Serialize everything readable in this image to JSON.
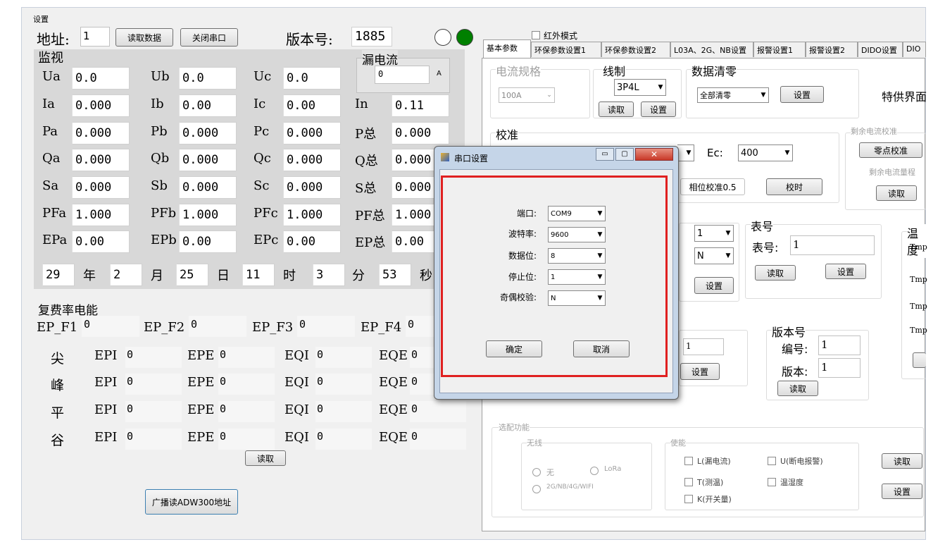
{
  "window": {
    "title": "设置"
  },
  "top": {
    "addr_label": "地址:",
    "addr_value": "1",
    "read_btn": "读取数据",
    "close_btn": "关闭串口",
    "ver_label": "版本号:",
    "ver_value": "1885"
  },
  "monitor": {
    "title": "监视",
    "leak_title": "漏电流",
    "leak_value": "0",
    "leak_unit": "A",
    "rows": [
      [
        {
          "l": "Ua",
          "v": "0.0"
        },
        {
          "l": "Ub",
          "v": "0.0"
        },
        {
          "l": "Uc",
          "v": "0.0"
        }
      ],
      [
        {
          "l": "Ia",
          "v": "0.000"
        },
        {
          "l": "Ib",
          "v": "0.00"
        },
        {
          "l": "Ic",
          "v": "0.00"
        },
        {
          "l": "In",
          "v": "0.11"
        }
      ],
      [
        {
          "l": "Pa",
          "v": "0.000"
        },
        {
          "l": "Pb",
          "v": "0.000"
        },
        {
          "l": "Pc",
          "v": "0.000"
        },
        {
          "l": "P总",
          "v": "0.000"
        }
      ],
      [
        {
          "l": "Qa",
          "v": "0.000"
        },
        {
          "l": "Qb",
          "v": "0.000"
        },
        {
          "l": "Qc",
          "v": "0.000"
        },
        {
          "l": "Q总",
          "v": "0.000"
        }
      ],
      [
        {
          "l": "Sa",
          "v": "0.000"
        },
        {
          "l": "Sb",
          "v": "0.000"
        },
        {
          "l": "Sc",
          "v": "0.000"
        },
        {
          "l": "S总",
          "v": "0.000"
        }
      ],
      [
        {
          "l": "PFa",
          "v": "1.000"
        },
        {
          "l": "PFb",
          "v": "1.000"
        },
        {
          "l": "PFc",
          "v": "1.000"
        },
        {
          "l": "PF总",
          "v": "1.000"
        }
      ],
      [
        {
          "l": "EPa",
          "v": "0.00"
        },
        {
          "l": "EPb",
          "v": "0.00"
        },
        {
          "l": "EPc",
          "v": "0.00"
        },
        {
          "l": "EP总",
          "v": "0.00"
        }
      ]
    ],
    "date": [
      {
        "v": "29",
        "u": "年"
      },
      {
        "v": "2",
        "u": "月"
      },
      {
        "v": "25",
        "u": "日"
      },
      {
        "v": "11",
        "u": "时"
      },
      {
        "v": "3",
        "u": "分"
      },
      {
        "v": "53",
        "u": "秒"
      }
    ]
  },
  "tariff": {
    "title": "复费率电能",
    "ep": [
      {
        "l": "EP_F1",
        "v": "0"
      },
      {
        "l": "EP_F2",
        "v": "0"
      },
      {
        "l": "EP_F3",
        "v": "0"
      },
      {
        "l": "EP_F4",
        "v": "0"
      }
    ],
    "rows": [
      {
        "name": "尖"
      },
      {
        "name": "峰"
      },
      {
        "name": "平"
      },
      {
        "name": "谷"
      }
    ],
    "cols": [
      {
        "l": "EPI",
        "v": "0"
      },
      {
        "l": "EPE",
        "v": "0"
      },
      {
        "l": "EQI",
        "v": "0"
      },
      {
        "l": "EQE",
        "v": "0"
      }
    ],
    "read_btn": "读取",
    "broadcast_btn": "广播读ADW300地址"
  },
  "right": {
    "ir_label": "红外模式",
    "tabs": [
      "基本参数",
      "环保参数设置1",
      "环保参数设置2",
      "L03A、2G、NB设置",
      "报警设置1",
      "报警设置2",
      "DIDO设置",
      "DIO"
    ],
    "spec_label": "电流规格",
    "spec_value": "100A",
    "wiring_label": "线制",
    "wiring_value": "3P4L",
    "wiring_read": "读取",
    "wiring_set": "设置",
    "clear_label": "数据清零",
    "clear_value": "全部清零",
    "clear_set": "设置",
    "special_label": "特供界面",
    "calib_label": "校准",
    "ec_label": "Ec:",
    "ec_value": "400",
    "phase_btn": "相位校准0.5",
    "calib_btn": "校时",
    "residual_label": "剩余电流校准",
    "zero_btn": "零点校准",
    "residual_range_label": "剩余电流量程",
    "residual_read": "读取",
    "cmb1": "1",
    "cmb2": "N",
    "set_btn": "设置",
    "meter_label": "表号",
    "meter_no_label": "表号:",
    "meter_no": "1",
    "meter_read": "读取",
    "meter_set": "设置",
    "temp_label": "温度",
    "t1": "Tmp",
    "t2": "Tmp",
    "t3": "Tmp",
    "t4": "Tmp",
    "mid_value": "1",
    "mid_set": "设置",
    "ver_label": "版本号",
    "code_label": "编号:",
    "code_value": "1",
    "version_label": "版本:",
    "version_value": "1",
    "ver_read": "读取",
    "opt_label": "选配功能",
    "wireless_label": "无线",
    "r1": "无",
    "r2": "LoRa",
    "r3": "2G/NB/4G/WIFI",
    "enable_label": "使能",
    "e1": "L(漏电流)",
    "e2": "U(断电报警)",
    "e3": "T(测温)",
    "e4": "温湿度",
    "e5": "K(开关量)",
    "opt_read": "读取",
    "opt_set": "设置"
  },
  "dialog": {
    "title": "串口设置",
    "port_label": "端口:",
    "port_value": "COM9",
    "baud_label": "波特率:",
    "baud_value": "9600",
    "data_label": "数据位:",
    "data_value": "8",
    "stop_label": "停止位:",
    "stop_value": "1",
    "parity_label": "奇偶校验:",
    "parity_value": "N",
    "ok": "确定",
    "cancel": "取消"
  },
  "colors": {
    "status_off": "#ffffff",
    "status_on": "#008000",
    "highlight": "#e02020"
  }
}
